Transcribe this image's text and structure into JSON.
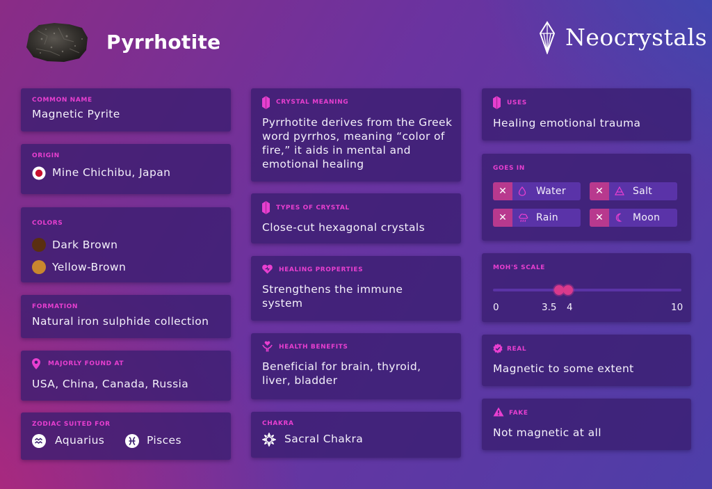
{
  "header": {
    "title": "Pyrrhotite",
    "brand": "Neocrystals"
  },
  "icons": {
    "rock": "rock-photo",
    "brand_logo": "crystal-logo-icon",
    "origin_flag": "japan-flag-icon",
    "location": "map-pin-icon",
    "crystal": "crystal-icon",
    "heart": "heart-icon",
    "hands": "hands-heart-icon",
    "chakra": "lotus-icon",
    "zodiac_aquarius": "aquarius-icon",
    "zodiac_pisces": "pisces-icon",
    "real": "check-badge-icon",
    "fake": "warning-icon",
    "water": "droplet-icon",
    "salt": "triangle-icon",
    "rain": "rain-cloud-icon",
    "moon": "moon-icon"
  },
  "colors": {
    "accent": "#e83fd0",
    "card": "#3a1e70",
    "pill_x": "#b8398e",
    "slider": "#d93a8c"
  },
  "left": {
    "common_name": {
      "label": "COMMON NAME",
      "value": "Magnetic Pyrite"
    },
    "origin": {
      "label": "ORIGIN",
      "value": "Mine Chichibu, Japan"
    },
    "colors": {
      "label": "COLORS",
      "items": [
        {
          "name": "Dark Brown",
          "hex": "#5a2f10"
        },
        {
          "name": "Yellow-Brown",
          "hex": "#c9872e"
        }
      ]
    },
    "formation": {
      "label": "FORMATION",
      "value": "Natural iron sulphide collection"
    },
    "found": {
      "label": "MAJORLY FOUND AT",
      "value": "USA, China, Canada, Russia"
    },
    "zodiac": {
      "label": "ZODIAC SUITED FOR",
      "items": [
        "Aquarius",
        "Pisces"
      ]
    }
  },
  "middle": {
    "meaning": {
      "label": "CRYSTAL MEANING",
      "value": "Pyrrhotite derives from the Greek word pyrrhos, meaning “color of fire,” it aids in mental and emotional healing"
    },
    "types": {
      "label": "TYPES OF CRYSTAL",
      "value": "Close-cut hexagonal crystals"
    },
    "healing": {
      "label": "HEALING PROPERTIES",
      "value": "Strengthens the immune system"
    },
    "health": {
      "label": "HEALTH BENEFITS",
      "value": "Beneficial for brain, thyroid, liver, bladder"
    },
    "chakra": {
      "label": "CHAKRA",
      "value": "Sacral Chakra"
    }
  },
  "right": {
    "uses": {
      "label": "USES",
      "value": "Healing emotional trauma"
    },
    "goes_in": {
      "label": "GOES IN",
      "items": [
        {
          "name": "Water",
          "icon": "droplet-icon",
          "remove": "✕"
        },
        {
          "name": "Salt",
          "icon": "triangle-icon",
          "remove": "✕"
        },
        {
          "name": "Rain",
          "icon": "rain-cloud-icon",
          "remove": "✕"
        },
        {
          "name": "Moon",
          "icon": "moon-icon",
          "remove": "✕"
        }
      ]
    },
    "mohs": {
      "label": "MOH'S SCALE",
      "min": "0",
      "low": "3.5",
      "high": "4",
      "max": "10",
      "range_min": 0,
      "range_max": 10,
      "value_low": 3.5,
      "value_high": 4
    },
    "real": {
      "label": "REAL",
      "value": "Magnetic to some extent"
    },
    "fake": {
      "label": "FAKE",
      "value": "Not magnetic at all"
    }
  }
}
